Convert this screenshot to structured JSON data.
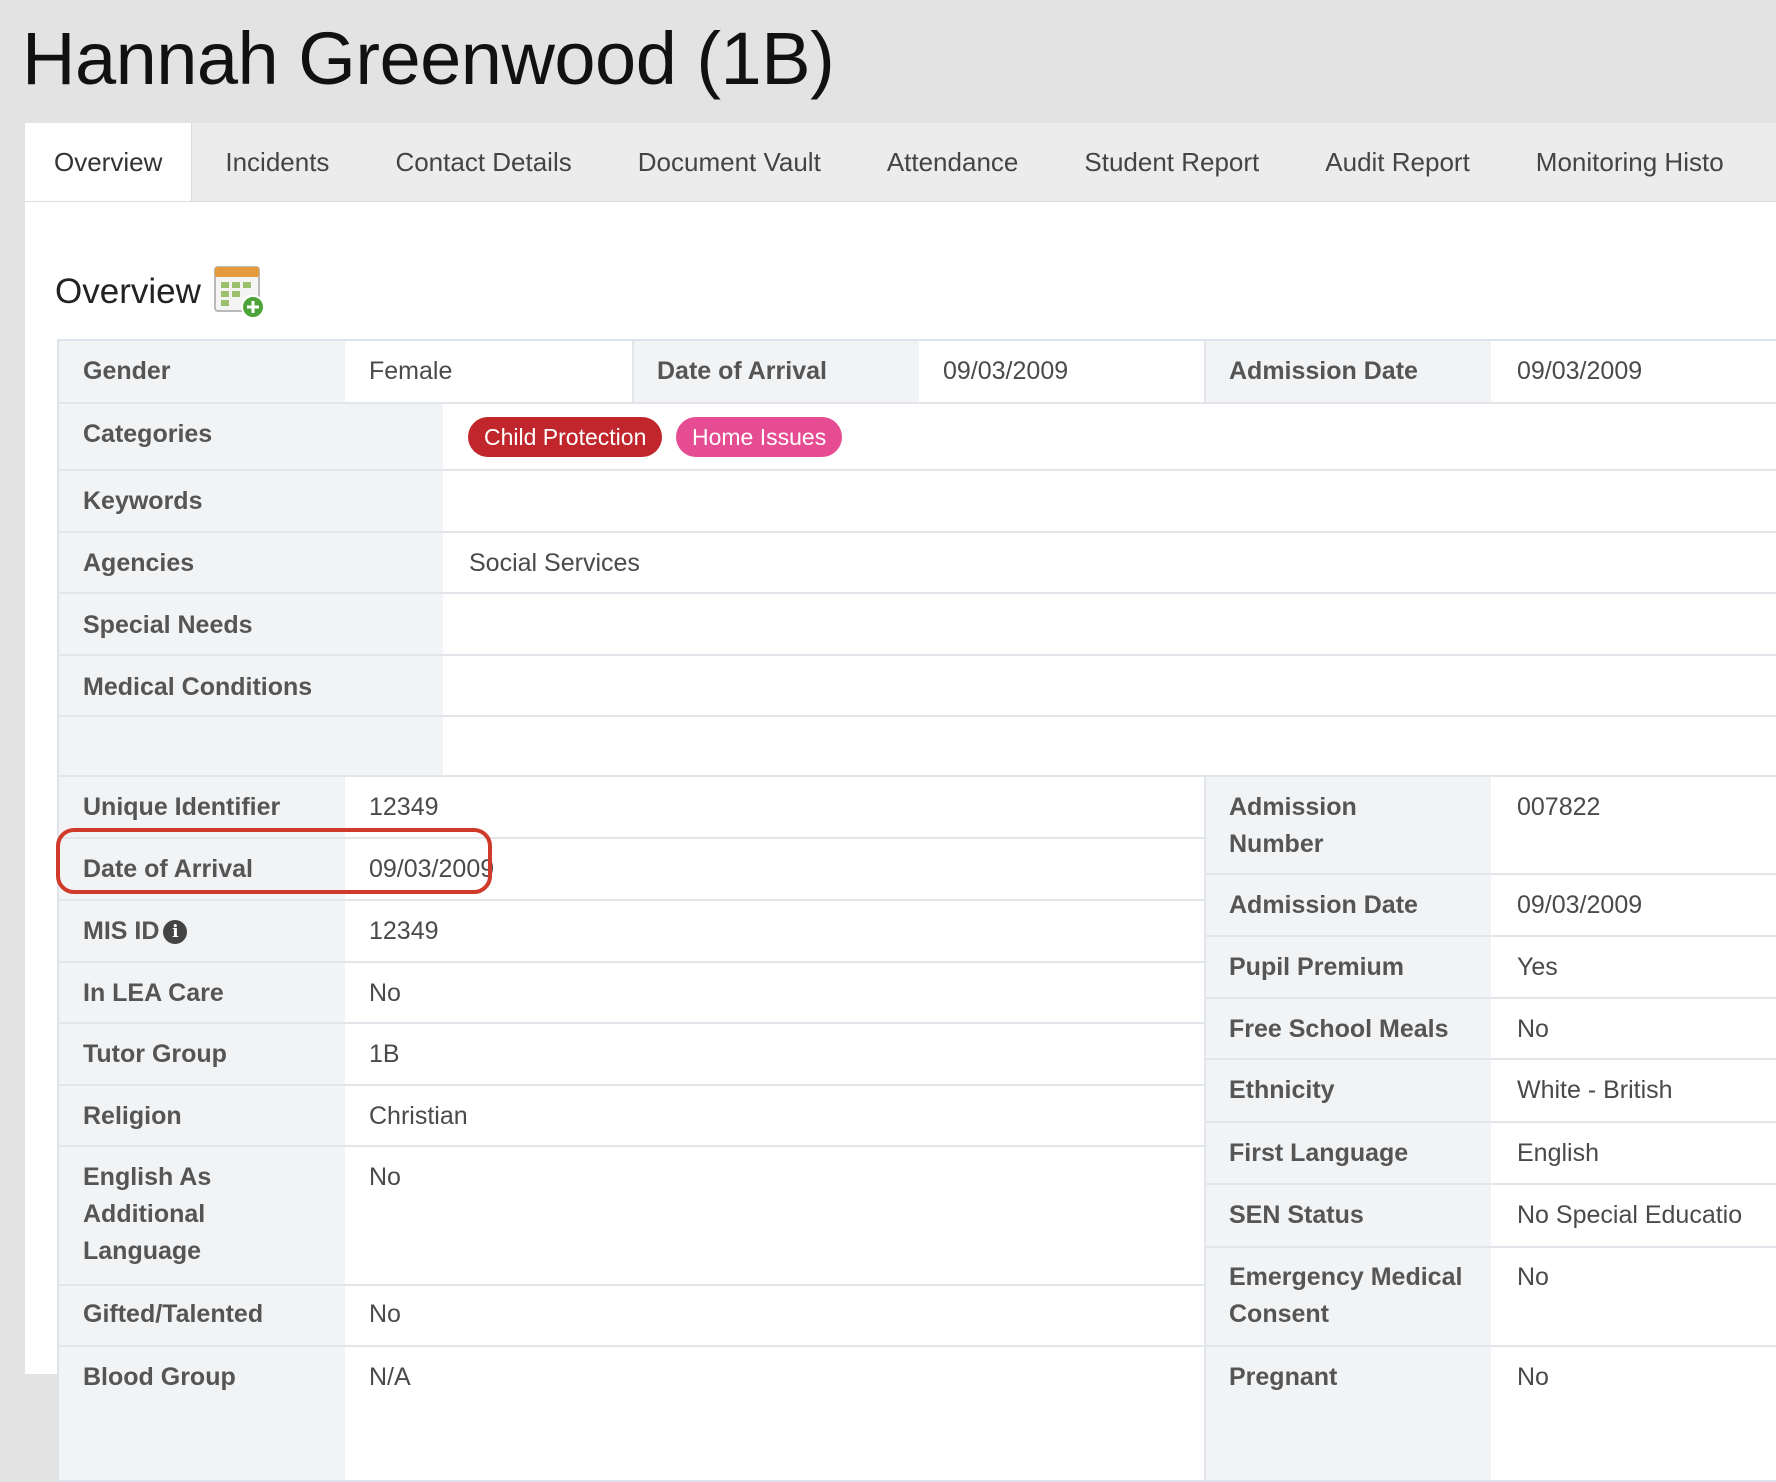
{
  "page_title": "Hannah Greenwood (1B)",
  "tabs": [
    {
      "label": "Overview",
      "active": true
    },
    {
      "label": "Incidents"
    },
    {
      "label": "Contact Details"
    },
    {
      "label": "Document Vault"
    },
    {
      "label": "Attendance"
    },
    {
      "label": "Student Report"
    },
    {
      "label": "Audit Report"
    },
    {
      "label": "Monitoring Histo"
    }
  ],
  "section": {
    "title": "Overview",
    "icon": "calendar-add-icon"
  },
  "top_row": {
    "gender_label": "Gender",
    "gender_value": "Female",
    "arrival_label": "Date of Arrival",
    "arrival_value": "09/03/2009",
    "admission_label": "Admission Date",
    "admission_value": "09/03/2009"
  },
  "categories": {
    "label": "Categories",
    "badges": [
      {
        "label": "Child Protection",
        "color": "#c0262c"
      },
      {
        "label": "Home Issues",
        "color": "#e64c92"
      }
    ]
  },
  "keywords": {
    "label": "Keywords",
    "value": ""
  },
  "agencies": {
    "label": "Agencies",
    "value": "Social Services"
  },
  "special_needs": {
    "label": "Special Needs",
    "value": ""
  },
  "medical_conditions": {
    "label": "Medical Conditions",
    "value": ""
  },
  "left_fields": [
    {
      "label": "Unique Identifier",
      "value": "12349"
    },
    {
      "label": "Date of Arrival",
      "value": "09/03/2009"
    },
    {
      "label": "MIS ID",
      "value": "12349",
      "info_icon": "info-icon"
    },
    {
      "label": "In LEA Care",
      "value": "No"
    },
    {
      "label": "Tutor Group",
      "value": "1B"
    },
    {
      "label": "Religion",
      "value": "Christian"
    },
    {
      "label": "English As Additional Language",
      "value": "No"
    },
    {
      "label": "Gifted/Talented",
      "value": "No"
    },
    {
      "label": "Blood Group",
      "value": "N/A"
    }
  ],
  "right_fields": [
    {
      "label": "Admission Number",
      "value": "007822"
    },
    {
      "label": "Admission Date",
      "value": "09/03/2009"
    },
    {
      "label": "Pupil Premium",
      "value": "Yes"
    },
    {
      "label": "Free School Meals",
      "value": "No"
    },
    {
      "label": "Ethnicity",
      "value": "White - British"
    },
    {
      "label": "First Language",
      "value": "English"
    },
    {
      "label": "SEN Status",
      "value": "No Special Educatio"
    },
    {
      "label": "Emergency Medical Consent",
      "value": "No"
    },
    {
      "label": "Pregnant",
      "value": "No"
    }
  ],
  "colors": {
    "highlight": "#cf3a2a",
    "label_bg": "#f1f3f5",
    "border": "#dde3ea"
  }
}
